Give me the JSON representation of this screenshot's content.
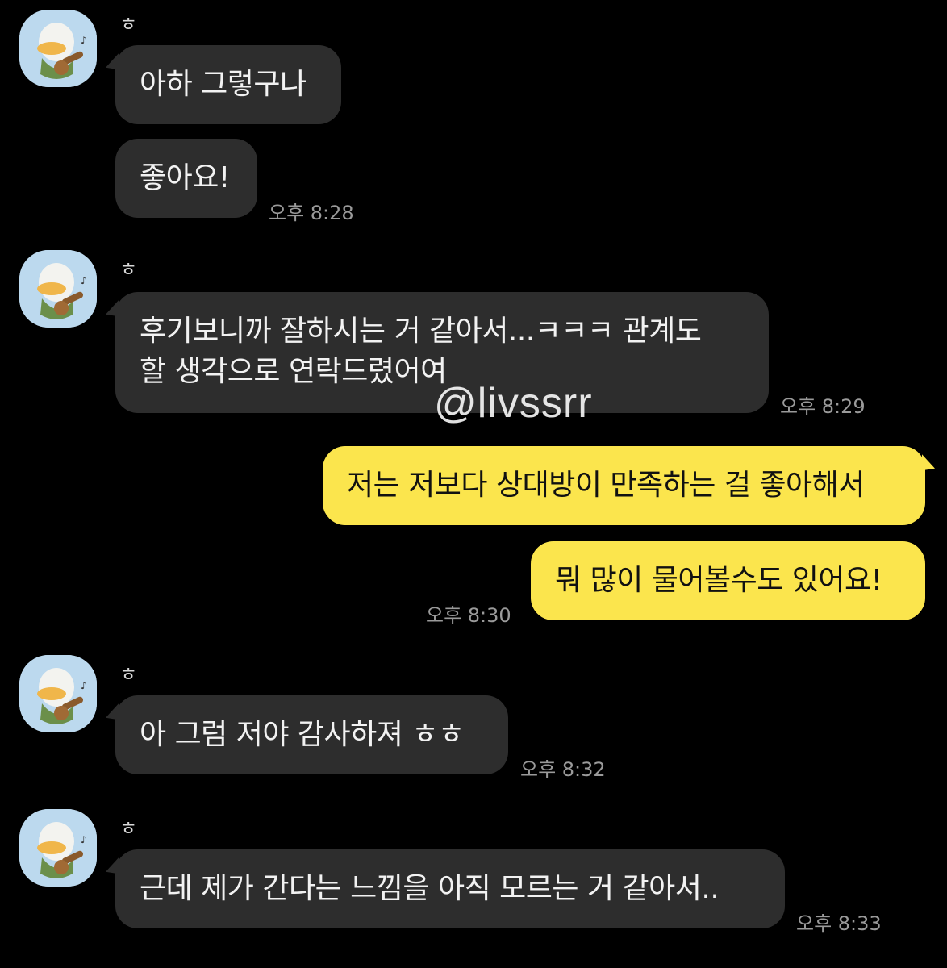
{
  "sender_name": "ㅎ",
  "watermark": "@livssrr",
  "colors": {
    "background": "#000000",
    "incoming_bubble": "#2d2d2d",
    "outgoing_bubble": "#fbe54d",
    "timestamp": "#9a9a9a",
    "avatar_bg": "#bcd9ee"
  },
  "messages": [
    {
      "id": "m1",
      "direction": "incoming",
      "text": "아하 그렇구나"
    },
    {
      "id": "m2",
      "direction": "incoming",
      "text": "좋아요!",
      "time": "오후 8:28"
    },
    {
      "id": "m3",
      "direction": "incoming",
      "lines": [
        "후기보니까 잘하시는 거 같아서...ㅋㅋㅋ 관계도",
        "할 생각으로 연락드렸어여"
      ],
      "time": "오후 8:29"
    },
    {
      "id": "m4",
      "direction": "outgoing",
      "text": "저는 저보다 상대방이 만족하는 걸 좋아해서"
    },
    {
      "id": "m5",
      "direction": "outgoing",
      "text": "뭐 많이 물어볼수도 있어요!",
      "time": "오후 8:30"
    },
    {
      "id": "m6",
      "direction": "incoming",
      "text": "아 그럼 저야 감사하져 ㅎㅎ",
      "time": "오후 8:32"
    },
    {
      "id": "m7",
      "direction": "incoming",
      "text": "근데 제가 간다는 느낌을 아직 모르는 거 같아서..",
      "time": "오후 8:33"
    }
  ],
  "avatar_icon": "duck-with-guitar-icon"
}
